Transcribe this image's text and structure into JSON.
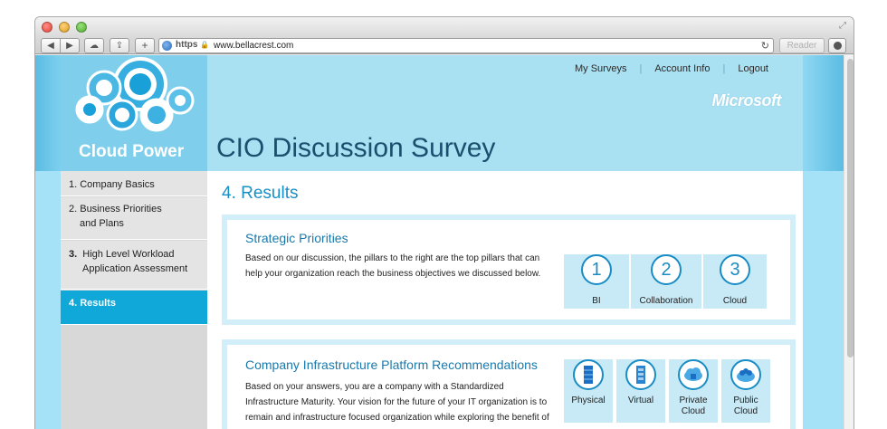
{
  "browser": {
    "protocol": "https",
    "url": "www.bellacrest.com",
    "reader_label": "Reader",
    "icons": [
      "back-icon",
      "forward-icon",
      "cloud-icon",
      "share-icon",
      "add-icon",
      "globe-icon",
      "lock-icon",
      "reload-icon",
      "download-icon",
      "fullscreen-icon"
    ]
  },
  "header": {
    "brand": "Cloud Power",
    "nav": [
      "My Surveys",
      "Account Info",
      "Logout"
    ],
    "partner_logo": "Microsoft",
    "title": "CIO Discussion Survey"
  },
  "sidebar": {
    "items": [
      {
        "label": "1. Company Basics"
      },
      {
        "label": "2. Business Priorities",
        "label2": "and Plans"
      },
      {
        "num": "3.",
        "label": "High Level Workload",
        "label2": "Application Assessment"
      },
      {
        "label": "4. Results"
      }
    ]
  },
  "main": {
    "section_title": "4. Results",
    "strategic": {
      "title": "Strategic Priorities",
      "line1": "Based on our discussion, the pillars to the right are the top pillars that can",
      "line2": "help your organization reach the business objectives we discussed below.",
      "pillars": [
        {
          "num": "1",
          "label": "BI"
        },
        {
          "num": "2",
          "label": "Collaboration"
        },
        {
          "num": "3",
          "label": "Cloud"
        }
      ]
    },
    "infrastructure": {
      "title": "Company Infrastructure Platform Recommendations",
      "line1": "Based on your answers, you are a company with a Standardized",
      "line2": "Infrastructure Maturity. Your vision for the future of your IT organization is to",
      "line3": "remain and infrastructure focused organization while exploring the benefit of",
      "platforms": [
        {
          "label": "Physical",
          "icon": "server-icon",
          "status_color": "#e8201c"
        },
        {
          "label": "Virtual",
          "icon": "virtual-server-icon",
          "status_color": "#b5e45a"
        },
        {
          "label": "Private\nCloud",
          "icon": "private-cloud-lock-icon",
          "status_color": "#b5e45a"
        },
        {
          "label": "Public\nCloud",
          "icon": "public-cloud-users-icon",
          "status_color": "#2f9e2f"
        }
      ]
    }
  },
  "colors": {
    "accent": "#10a8d8",
    "header_bg": "#a9e0f2",
    "title": "#1c4f6e",
    "link_blue": "#1890c6"
  }
}
